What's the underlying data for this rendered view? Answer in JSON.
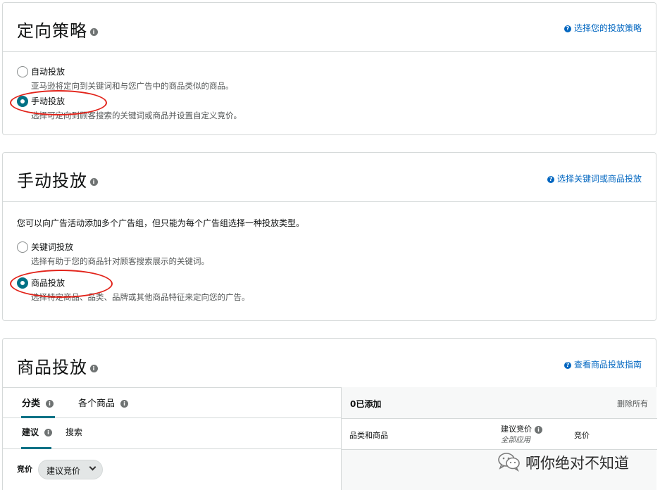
{
  "section1": {
    "title": "定向策略",
    "help_link": "选择您的投放策略",
    "options": [
      {
        "label": "自动投放",
        "desc": "亚马逊将定向到关键词和与您广告中的商品类似的商品。",
        "checked": false
      },
      {
        "label": "手动投放",
        "desc": "选择可定向到顾客搜索的关键词或商品并设置自定义竞价。",
        "checked": true
      }
    ]
  },
  "section2": {
    "title": "手动投放",
    "help_link": "选择关键词或商品投放",
    "intro": "您可以向广告活动添加多个广告组，但只能为每个广告组选择一种投放类型。",
    "options": [
      {
        "label": "关键词投放",
        "desc": "选择有助于您的商品针对顾客搜索展示的关键词。",
        "checked": false
      },
      {
        "label": "商品投放",
        "desc": "选择特定商品、品类、品牌或其他商品特征来定向您的广告。",
        "checked": true
      }
    ]
  },
  "section3": {
    "title": "商品投放",
    "help_link": "查看商品投放指南",
    "tabs": [
      "分类",
      "各个商品"
    ],
    "subtabs": [
      "建议",
      "搜索"
    ],
    "bid_label": "竞价",
    "bid_select": "建议竞价",
    "added": "0已添加",
    "remove_all": "删除所有",
    "col_category": "品类和商品",
    "col_suggested": "建议竞价",
    "col_suggested_sub": "全部应用",
    "col_bid": "竞价"
  },
  "watermark": {
    "text": "啊你绝对不知道"
  },
  "colors": {
    "accent": "#007185",
    "link": "#0066c0",
    "annotation": "#e2231a"
  }
}
